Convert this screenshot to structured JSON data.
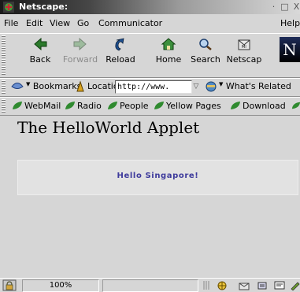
{
  "window": {
    "title": "Netscape:"
  },
  "menubar": {
    "items": [
      "File",
      "Edit",
      "View",
      "Go",
      "Communicator",
      "Help"
    ]
  },
  "nav_toolbar": {
    "buttons": [
      {
        "label": "Back",
        "icon": "back-arrow-icon"
      },
      {
        "label": "Forward",
        "icon": "forward-arrow-icon"
      },
      {
        "label": "Reload",
        "icon": "reload-icon"
      },
      {
        "label": "Home",
        "icon": "home-icon"
      },
      {
        "label": "Search",
        "icon": "search-icon"
      },
      {
        "label": "Netscap",
        "icon": "netscape-mail-icon"
      }
    ],
    "logo_letter": "N"
  },
  "location_toolbar": {
    "bookmarks_label": "Bookmarks",
    "location_label": "Location:",
    "url": "http://www.",
    "related_label": "What's Related"
  },
  "personal_toolbar": {
    "items": [
      "WebMail",
      "Radio",
      "People",
      "Yellow Pages",
      "Download"
    ]
  },
  "content": {
    "heading": "The HelloWorld Applet",
    "applet_text": "Hello Singapore!",
    "colors": {
      "applet_text": "#3e3b9c",
      "applet_bg": "#e2e2e2"
    }
  },
  "statusbar": {
    "progress": "100%"
  }
}
